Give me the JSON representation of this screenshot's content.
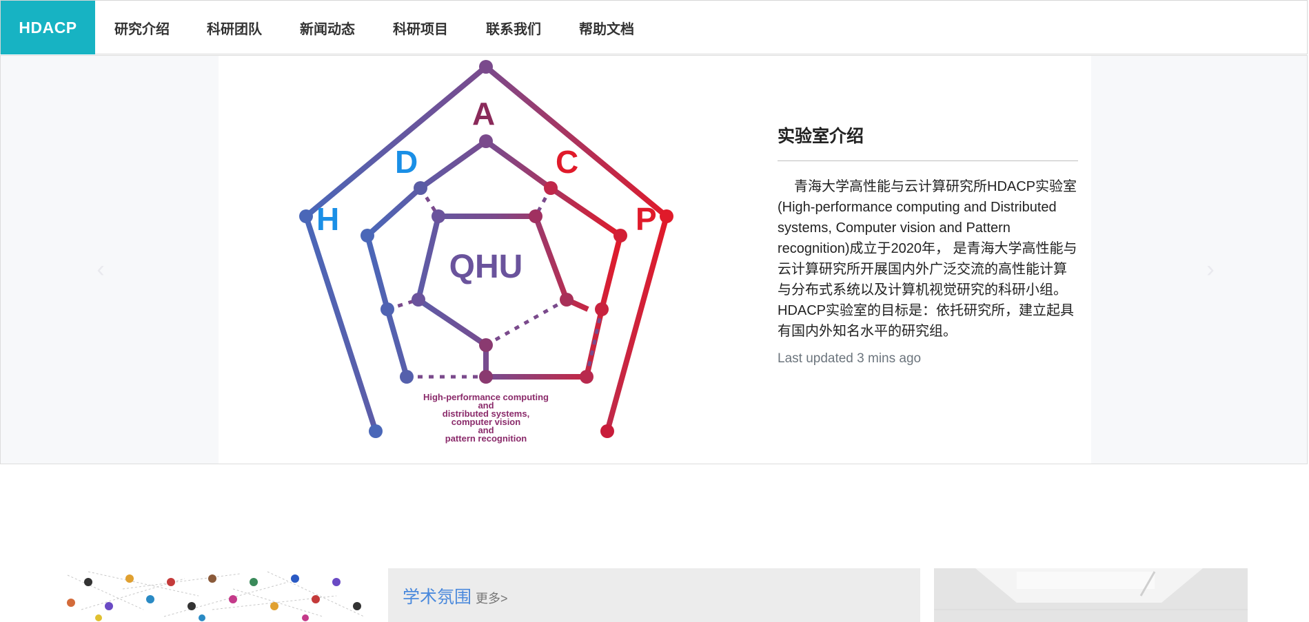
{
  "nav": {
    "brand": "HDACP",
    "items": [
      "研究介绍",
      "科研团队",
      "新闻动态",
      "科研项目",
      "联系我们",
      "帮助文档"
    ]
  },
  "carousel": {
    "prev_icon": "chevron-left-icon",
    "next_icon": "chevron-right-icon",
    "logo": {
      "letters": [
        "H",
        "D",
        "A",
        "C",
        "P"
      ],
      "center": "QHU",
      "tagline": [
        "High-performance computing",
        "and",
        "distributed systems,",
        "computer vision",
        "and",
        "pattern recognition"
      ]
    },
    "intro": {
      "title": "实验室介绍",
      "text": "青海大学高性能与云计算研究所HDACP实验室(High-performance computing and Distributed systems, Computer vision and Pattern recognition)成立于2020年， 是青海大学高性能与云计算研究所开展国内外广泛交流的高性能计算与分布式系统以及计算机视觉研究的科研小组。 HDACP实验室的目标是：依托研究所，建立起具有国内外知名水平的研究组。",
      "updated": "Last updated 3 mins ago"
    }
  },
  "section": {
    "title": "学术氛围",
    "more": "更多>"
  },
  "colors": {
    "brand": "#17b3c3",
    "blue": "#4a67b8",
    "purple": "#7a4a8c",
    "red": "#e01a2a",
    "letter_blue": "#1a8fe6",
    "link": "#4a89dc"
  }
}
